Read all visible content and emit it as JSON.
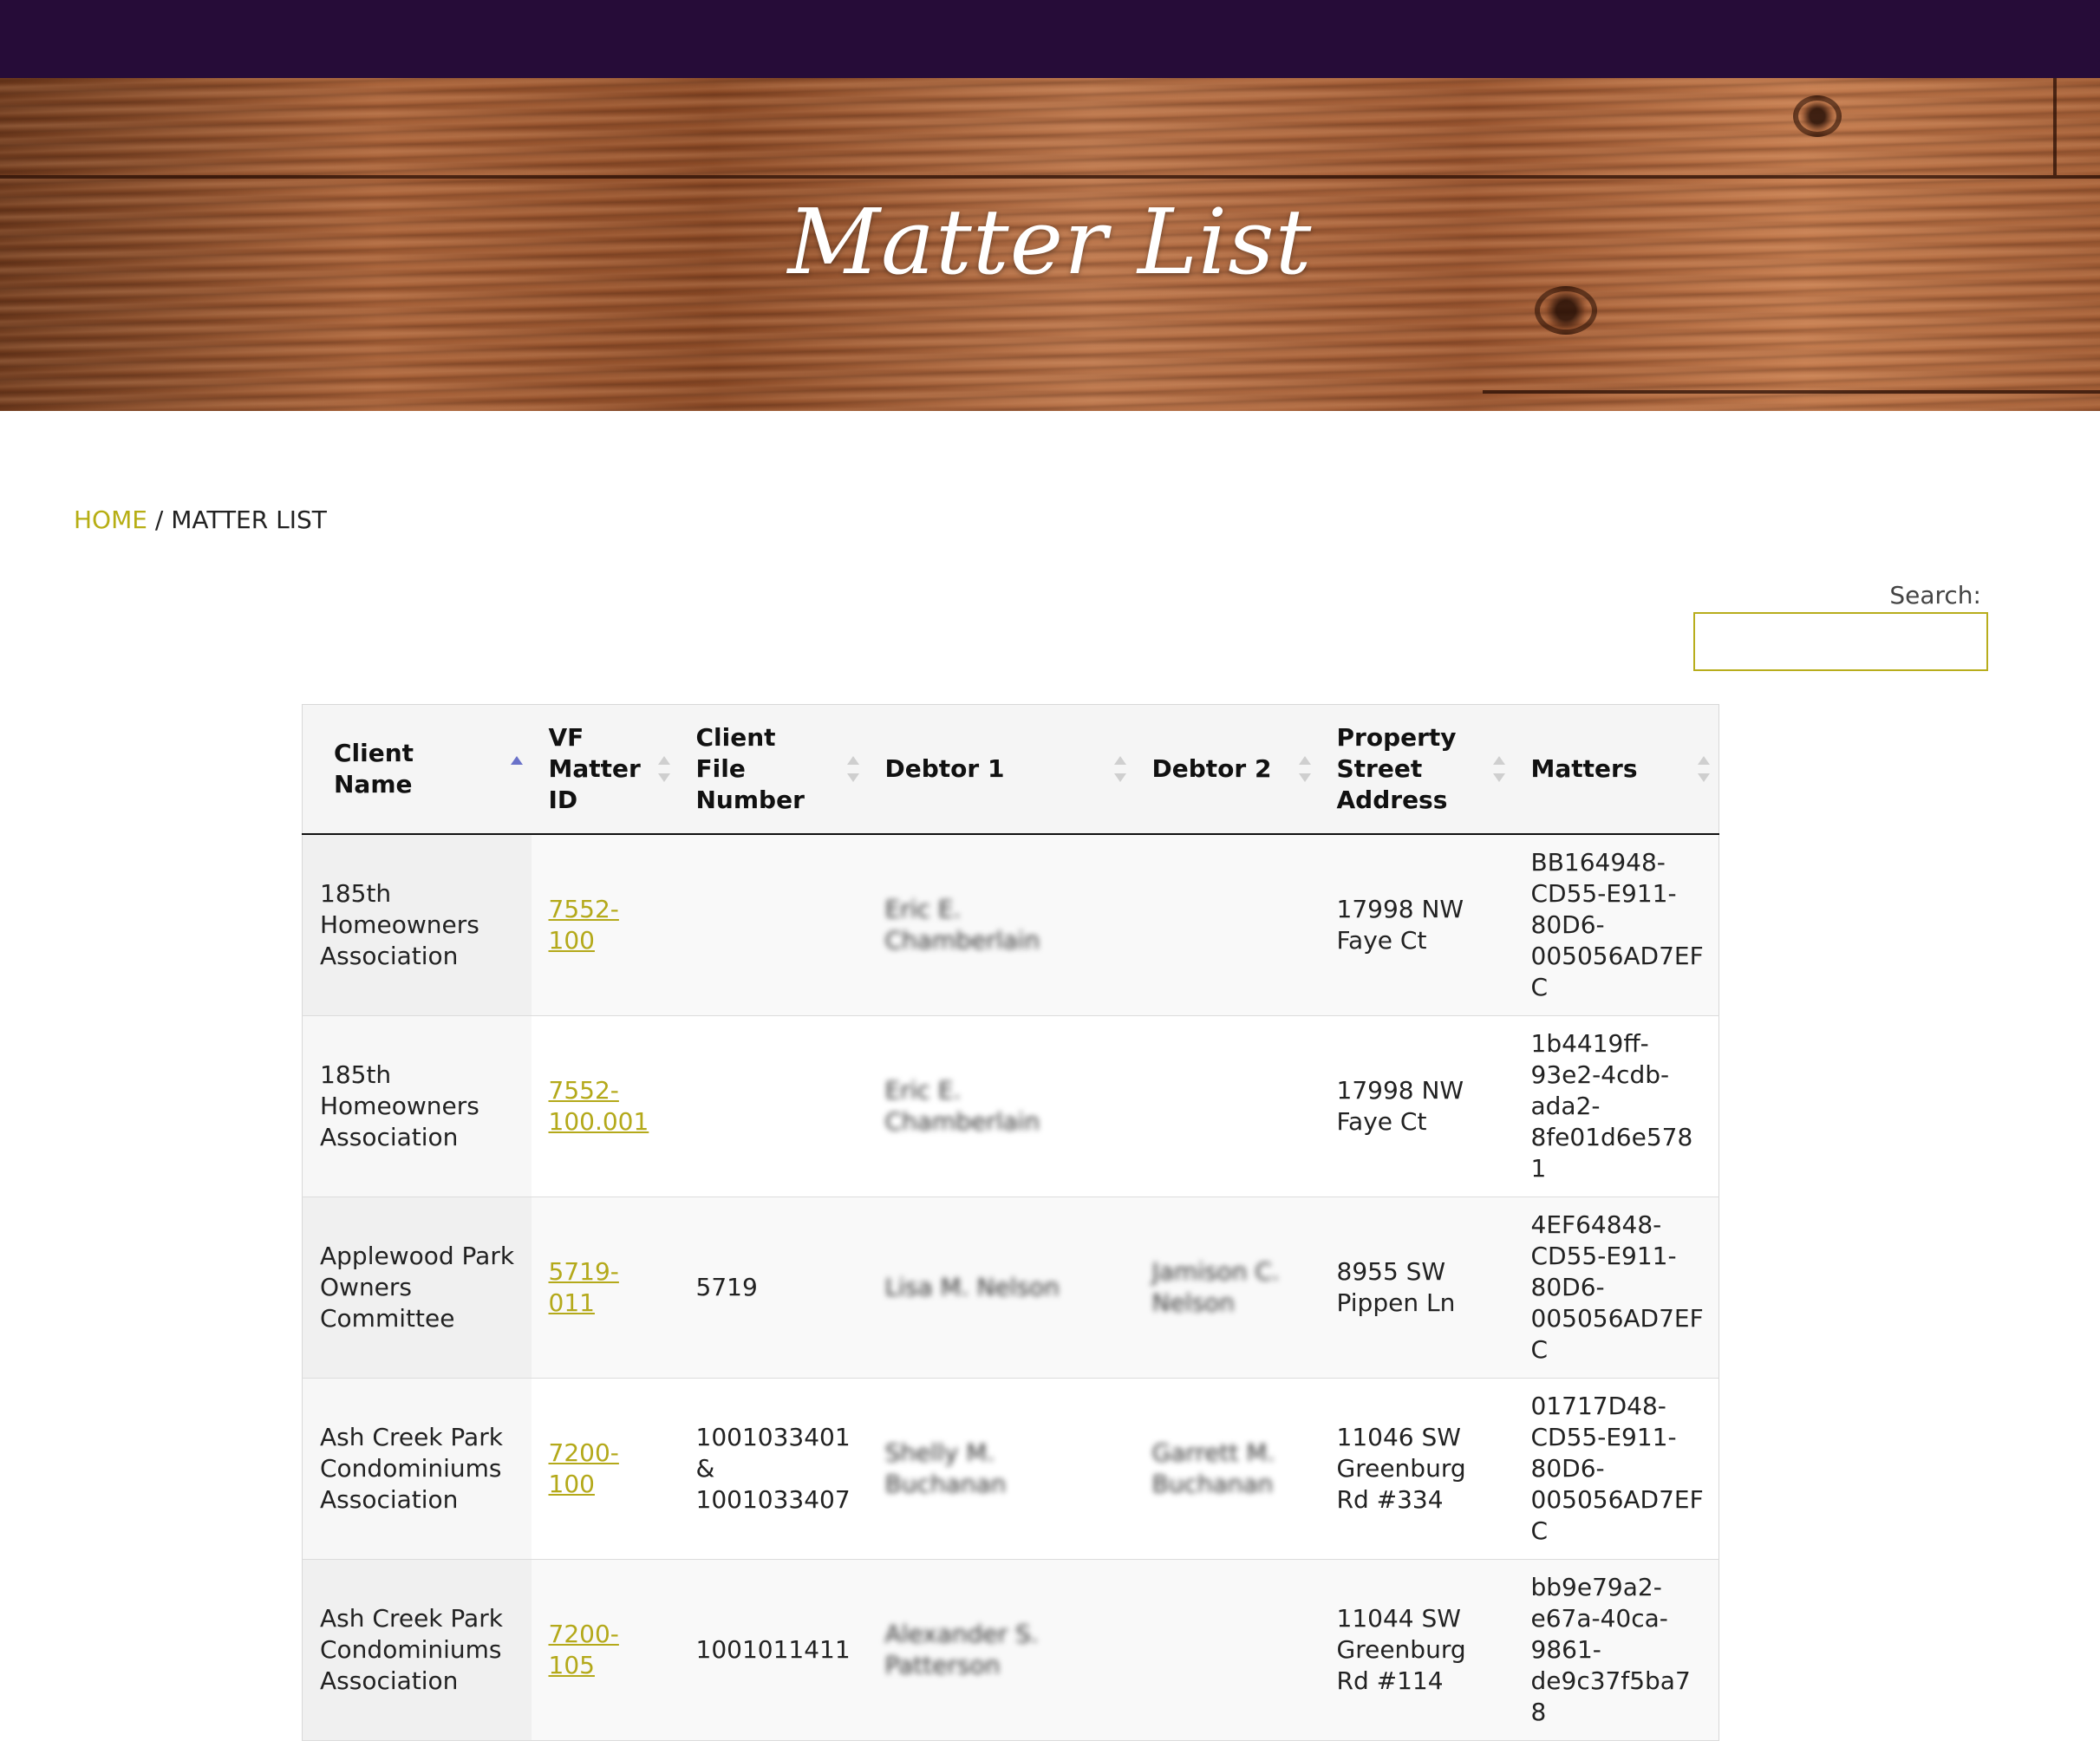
{
  "hero": {
    "title": "Matter List"
  },
  "breadcrumb": {
    "home": "HOME",
    "separator": " / ",
    "current": "MATTER LIST"
  },
  "search": {
    "label": "Search:",
    "value": "",
    "placeholder": ""
  },
  "colors": {
    "topbar": "#260c38",
    "link": "#b7ae14",
    "sort_active": "#6a72c9"
  },
  "table": {
    "columns": [
      {
        "label": "Client Name",
        "sort": "asc"
      },
      {
        "label": "VF Matter ID",
        "sort": "none"
      },
      {
        "label": "Client File Number",
        "sort": "none"
      },
      {
        "label": "Debtor 1",
        "sort": "none"
      },
      {
        "label": "Debtor 2",
        "sort": "none"
      },
      {
        "label": "Property Street Address",
        "sort": "none"
      },
      {
        "label": "Matters",
        "sort": "none"
      }
    ],
    "rows": [
      {
        "client": "185th Homeowners Association",
        "matter_id": "7552-100",
        "file_number": "",
        "debtor1": "Eric E. Chamberlain",
        "debtor2": "",
        "address": "17998 NW Faye Ct",
        "matter_guid": "BB164948-CD55-E911-80D6-005056AD7EFC"
      },
      {
        "client": "185th Homeowners Association",
        "matter_id": "7552-100.001",
        "file_number": "",
        "debtor1": "Eric E. Chamberlain",
        "debtor2": "",
        "address": "17998 NW Faye Ct",
        "matter_guid": "1b4419ff-93e2-4cdb-ada2-8fe01d6e5781"
      },
      {
        "client": "Applewood Park Owners Committee",
        "matter_id": "5719-011",
        "file_number": "5719",
        "debtor1": "Lisa M. Nelson",
        "debtor2": "Jamison C. Nelson",
        "address": "8955 SW Pippen Ln",
        "matter_guid": "4EF64848-CD55-E911-80D6-005056AD7EFC"
      },
      {
        "client": "Ash Creek Park Condominiums Association",
        "matter_id": "7200-100",
        "file_number": "1001033401 & 1001033407",
        "debtor1": "Shelly M. Buchanan",
        "debtor2": "Garrett M. Buchanan",
        "address": "11046 SW Greenburg Rd #334",
        "matter_guid": "01717D48-CD55-E911-80D6-005056AD7EFC"
      },
      {
        "client": "Ash Creek Park Condominiums Association",
        "matter_id": "7200-105",
        "file_number": "1001011411",
        "debtor1": "Alexander S. Patterson",
        "debtor2": "",
        "address": "11044 SW Greenburg Rd #114",
        "matter_guid": "bb9e79a2-e67a-40ca-9861-de9c37f5ba78"
      }
    ]
  }
}
